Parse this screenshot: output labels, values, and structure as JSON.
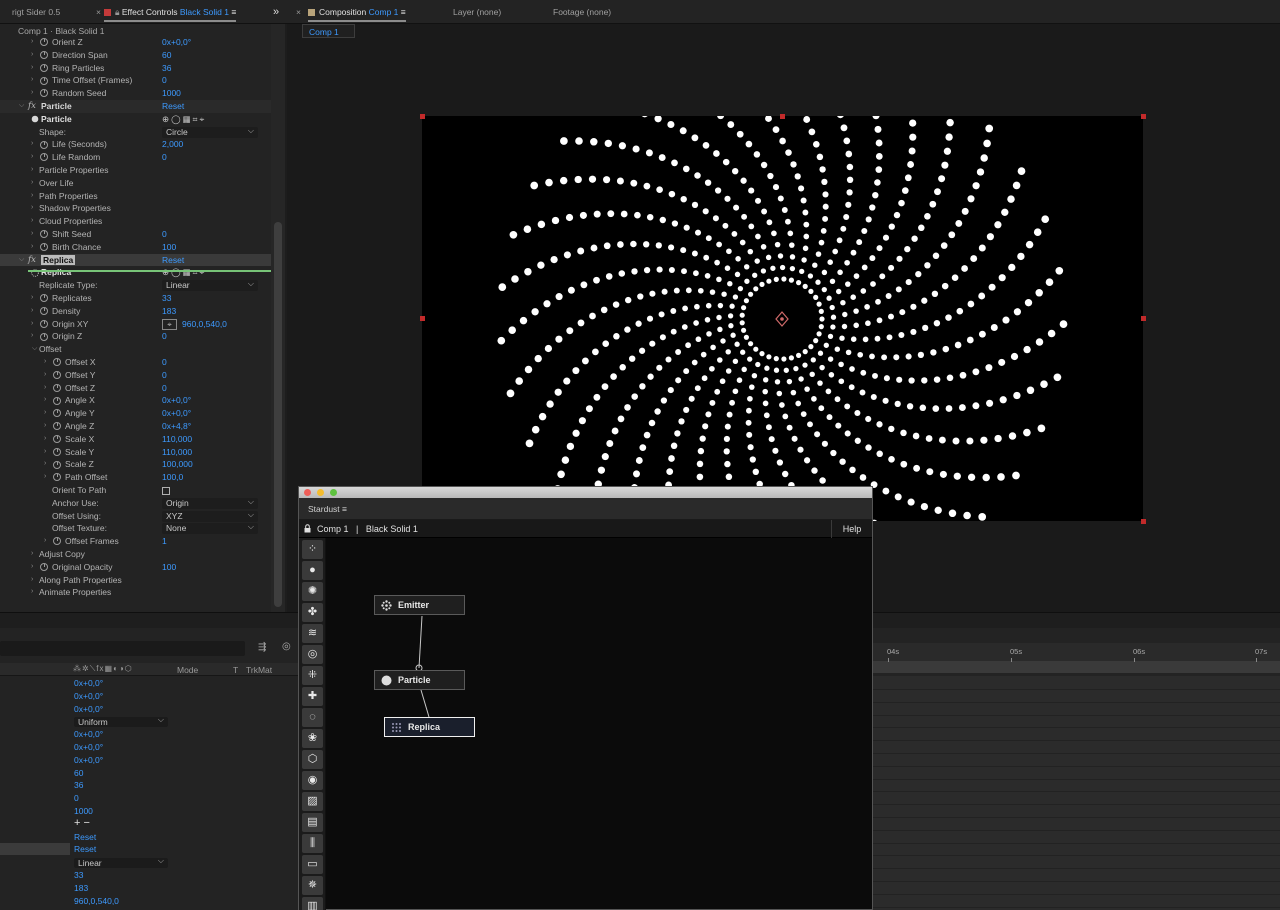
{
  "tabs": {
    "left_cut": "rigt Sider 0.5",
    "effect_controls_label": "Effect Controls",
    "effect_controls_layer": "Black Solid 1",
    "composition_label": "Composition",
    "composition_name": "Comp 1",
    "layer_panel": "Layer (none)",
    "footage_panel": "Footage (none)",
    "close_glyph": "×",
    "menu_glyph": "≡",
    "overflow_glyph": "»"
  },
  "effect_controls": {
    "header": "Comp 1 · Black Solid 1",
    "rows": [
      {
        "name": "Orient Z",
        "value": "0x+0,0°"
      },
      {
        "name": "Direction Span",
        "value": "60"
      },
      {
        "name": "Ring Particles",
        "value": "36"
      },
      {
        "name": "Time Offset (Frames)",
        "value": "0"
      },
      {
        "name": "Random Seed",
        "value": "1000"
      },
      {
        "name": "Particle",
        "value": "Reset"
      },
      {
        "name": "Particle",
        "value": ""
      },
      {
        "name": "Shape:",
        "value": "Circle"
      },
      {
        "name": "Life (Seconds)",
        "value": "2,000"
      },
      {
        "name": "Life Random",
        "value": "0"
      },
      {
        "name": "Particle Properties",
        "value": ""
      },
      {
        "name": "Over Life",
        "value": ""
      },
      {
        "name": "Path Properties",
        "value": ""
      },
      {
        "name": "Shadow Properties",
        "value": ""
      },
      {
        "name": "Cloud Properties",
        "value": ""
      },
      {
        "name": "Shift Seed",
        "value": "0"
      },
      {
        "name": "Birth Chance",
        "value": "100"
      },
      {
        "name": "Replica",
        "value": "Reset"
      },
      {
        "name": "Replica",
        "value": ""
      },
      {
        "name": "Replicate Type:",
        "value": "Linear"
      },
      {
        "name": "Replicates",
        "value": "33"
      },
      {
        "name": "Density",
        "value": "183"
      },
      {
        "name": "Origin XY",
        "value": "960,0,540,0"
      },
      {
        "name": "Origin Z",
        "value": "0"
      },
      {
        "name": "Offset",
        "value": ""
      },
      {
        "name": "Offset X",
        "value": "0"
      },
      {
        "name": "Offset Y",
        "value": "0"
      },
      {
        "name": "Offset Z",
        "value": "0"
      },
      {
        "name": "Angle X",
        "value": "0x+0,0°"
      },
      {
        "name": "Angle Y",
        "value": "0x+0,0°"
      },
      {
        "name": "Angle Z",
        "value": "0x+4,8°"
      },
      {
        "name": "Scale X",
        "value": "110,000"
      },
      {
        "name": "Scale Y",
        "value": "110,000"
      },
      {
        "name": "Scale Z",
        "value": "100,000"
      },
      {
        "name": "Path Offset",
        "value": "100,0"
      },
      {
        "name": "Orient To Path",
        "value": ""
      },
      {
        "name": "Anchor Use:",
        "value": "Origin"
      },
      {
        "name": "Offset Using:",
        "value": "XYZ"
      },
      {
        "name": "Offset Texture:",
        "value": "None"
      },
      {
        "name": "Offset Frames",
        "value": "1"
      },
      {
        "name": "Adjust Copy",
        "value": ""
      },
      {
        "name": "Original Opacity",
        "value": "100"
      },
      {
        "name": "Along Path Properties",
        "value": ""
      },
      {
        "name": "Animate Properties",
        "value": ""
      }
    ]
  },
  "composition": {
    "sub_tab": "Comp 1"
  },
  "timeline": {
    "header": {
      "mode": "Mode",
      "t": "T",
      "trkmat": "TrkMat"
    },
    "values": [
      "0x+0,0°",
      "0x+0,0°",
      "0x+0,0°",
      "Uniform",
      "0x+0,0°",
      "0x+0,0°",
      "0x+0,0°",
      "60",
      "36",
      "0",
      "1000",
      "+ −",
      "Reset",
      "Reset",
      "Linear",
      "33",
      "183",
      "960,0,540,0"
    ],
    "ticks": [
      "04s",
      "05s",
      "06s",
      "07s"
    ]
  },
  "stardust": {
    "tab": "Stardust",
    "comp": "Comp 1",
    "separator": "|",
    "layer": "Black Solid 1",
    "help": "Help",
    "nodes": {
      "emitter": "Emitter",
      "particle": "Particle",
      "replica": "Replica"
    },
    "toolbar_icons": [
      "emitter-icon",
      "particle-icon",
      "burst-icon",
      "fan-icon",
      "turbulence-icon",
      "ring-icon",
      "replica-icon",
      "plus-icon",
      "dotted-circle-icon",
      "group-icon",
      "cube-icon",
      "sphere-icon",
      "hatch-icon",
      "texture-icon",
      "bars-icon",
      "rectangle-icon",
      "model-icon",
      "stripes-icon"
    ]
  },
  "colors": {
    "accent_blue": "#3d9aff",
    "handle_red": "#c22a2a",
    "effect_underline": "#78c478",
    "traffic_red": "#ee5e58",
    "traffic_yellow": "#f4bc2f",
    "traffic_green": "#5ec23f"
  }
}
